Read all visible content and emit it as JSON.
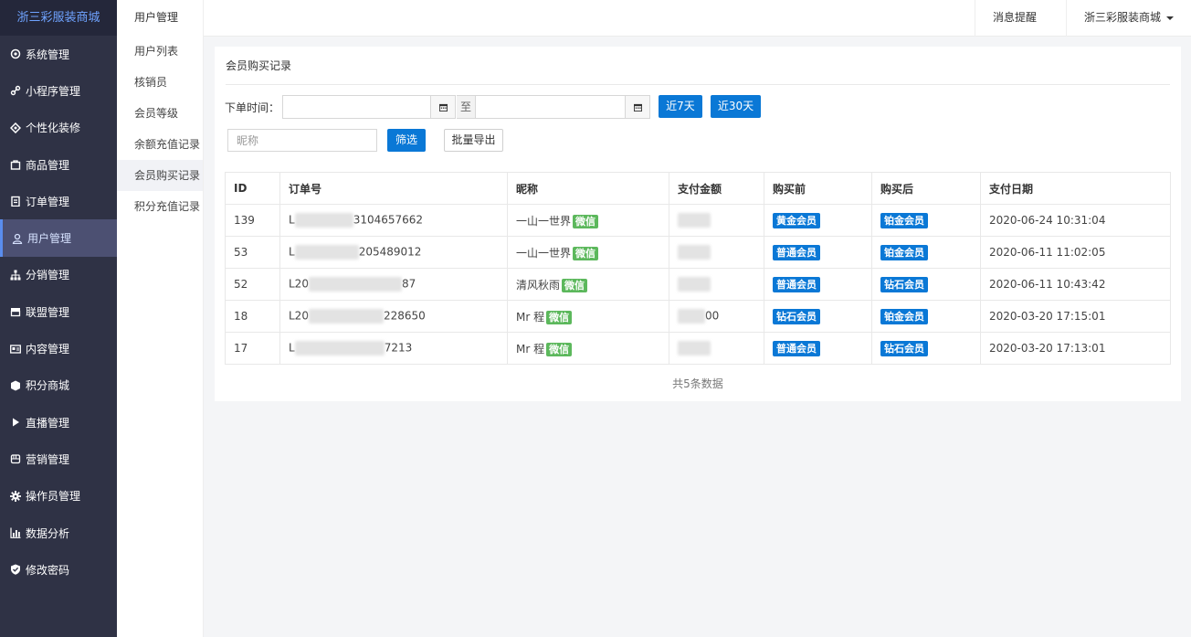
{
  "brand": "浙三彩服装商城",
  "sidebar": {
    "items": [
      {
        "label": "系统管理",
        "icon": "gear-circle-icon"
      },
      {
        "label": "小程序管理",
        "icon": "link-icon"
      },
      {
        "label": "个性化装修",
        "icon": "diamond-icon"
      },
      {
        "label": "商品管理",
        "icon": "bag-icon"
      },
      {
        "label": "订单管理",
        "icon": "clipboard-icon"
      },
      {
        "label": "用户管理",
        "icon": "user-icon",
        "active": true
      },
      {
        "label": "分销管理",
        "icon": "sitemap-icon"
      },
      {
        "label": "联盟管理",
        "icon": "store-icon"
      },
      {
        "label": "内容管理",
        "icon": "id-card-icon"
      },
      {
        "label": "积分商城",
        "icon": "cube-icon"
      },
      {
        "label": "直播管理",
        "icon": "play-icon"
      },
      {
        "label": "营销管理",
        "icon": "fist-icon"
      },
      {
        "label": "操作员管理",
        "icon": "cog-icon"
      },
      {
        "label": "数据分析",
        "icon": "bar-chart-icon"
      },
      {
        "label": "修改密码",
        "icon": "shield-check-icon"
      }
    ]
  },
  "subnav": {
    "title": "用户管理",
    "items": [
      {
        "label": "用户列表"
      },
      {
        "label": "核销员"
      },
      {
        "label": "会员等级"
      },
      {
        "label": "余额充值记录"
      },
      {
        "label": "会员购买记录",
        "active": true
      },
      {
        "label": "积分充值记录"
      }
    ]
  },
  "topbar": {
    "messages": "消息提醒",
    "store": "浙三彩服装商城"
  },
  "page": {
    "title": "会员购买记录",
    "filter": {
      "date_label": "下单时间：",
      "to_label": "至",
      "start_date": "",
      "end_date": "",
      "last7": "近7天",
      "last30": "近30天",
      "nickname_placeholder": "昵称",
      "filter_button": "筛选",
      "export_button": "批量导出"
    },
    "table": {
      "headers": [
        "ID",
        "订单号",
        "昵称",
        "支付金额",
        "购买前",
        "购买后",
        "支付日期"
      ],
      "rows": [
        {
          "id": "139",
          "order_prefix": "L",
          "order_suffix": "3104657662",
          "nickname": "一山一世界",
          "tag": "微信",
          "before": "黄金会员",
          "after": "铂金会员",
          "date": "2020-06-24 10:31:04"
        },
        {
          "id": "53",
          "order_prefix": "L",
          "order_suffix": "205489012",
          "nickname": "一山一世界",
          "tag": "微信",
          "before": "普通会员",
          "after": "铂金会员",
          "date": "2020-06-11 11:02:05"
        },
        {
          "id": "52",
          "order_prefix": "L20",
          "order_suffix": "87",
          "nickname": "清风秋雨",
          "tag": "微信",
          "before": "普通会员",
          "after": "钻石会员",
          "date": "2020-06-11 10:43:42"
        },
        {
          "id": "18",
          "order_prefix": "L20",
          "order_suffix": "228650",
          "nickname": "Mr 程",
          "tag": "微信",
          "amount_suffix": "00",
          "before": "钻石会员",
          "after": "铂金会员",
          "date": "2020-03-20 17:15:01"
        },
        {
          "id": "17",
          "order_prefix": "L",
          "order_suffix": "7213",
          "nickname": "Mr 程",
          "tag": "微信",
          "before": "普通会员",
          "after": "钻石会员",
          "date": "2020-03-20 17:13:01"
        }
      ]
    },
    "footer": "共5条数据"
  }
}
